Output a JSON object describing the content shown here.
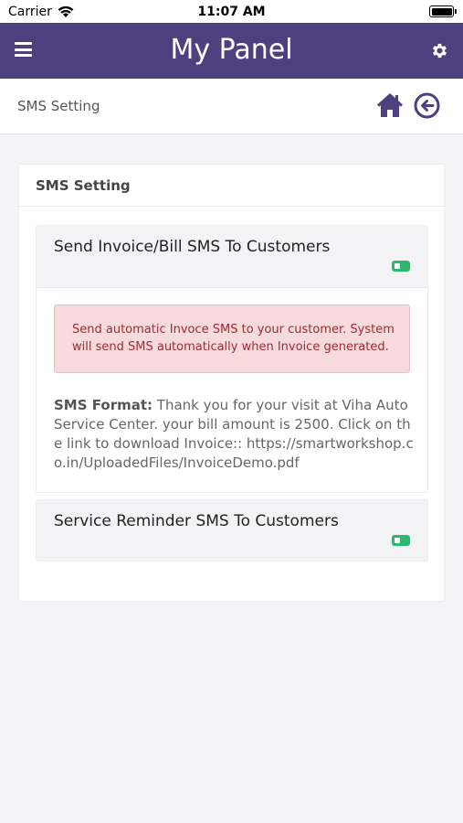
{
  "status_bar": {
    "carrier": "Carrier",
    "time": "11:07 AM"
  },
  "app_bar": {
    "title": "My Panel"
  },
  "sub_bar": {
    "title": "SMS Setting"
  },
  "card": {
    "title": "SMS Setting",
    "invoice_panel": {
      "title": "Send Invoice/Bill SMS To Customers",
      "enabled": true,
      "alert": "Send automatic Invoce SMS to your customer. System will send SMS automatically when Invoice generated.",
      "format_label": "SMS Format:",
      "format_text": " Thank you for your visit at Viha Auto Service Center. your bill amount is 2500. Click on the link to download Invoice:: https://smartworkshop.co.in/UploadedFiles/InvoiceDemo.pdf"
    },
    "reminder_panel": {
      "title": "Service Reminder SMS To Customers",
      "enabled": true
    }
  },
  "colors": {
    "primary": "#4e3f7f",
    "toggle_on": "#2db86e",
    "alert_bg": "#f6dadc",
    "alert_text": "#a12a33"
  }
}
